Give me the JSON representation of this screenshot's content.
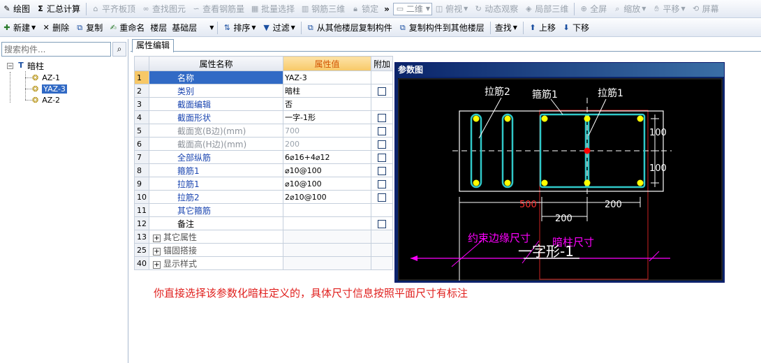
{
  "toolbar1": {
    "items": [
      {
        "label": "绘图",
        "icon": "pencil-icon",
        "disabled": false
      },
      {
        "label": "汇总计算",
        "icon": "sigma-icon",
        "disabled": false
      },
      {
        "label": "平齐板顶",
        "icon": "align-top-icon",
        "disabled": true
      },
      {
        "label": "查找图元",
        "icon": "binoculars-icon",
        "disabled": true
      },
      {
        "label": "查看钢筋量",
        "icon": "glasses-icon",
        "disabled": true
      },
      {
        "label": "批量选择",
        "icon": "batch-select-icon",
        "disabled": true
      },
      {
        "label": "钢筋三维",
        "icon": "rebar-3d-icon",
        "disabled": true
      },
      {
        "label": "锁定",
        "icon": "lock-icon",
        "disabled": true
      }
    ],
    "overflow": "»",
    "view_combo": "二维",
    "right_items": [
      {
        "label": "俯视",
        "icon": "top-view-icon"
      },
      {
        "label": "动态观察",
        "icon": "orbit-icon"
      },
      {
        "label": "局部三维",
        "icon": "local-3d-icon"
      },
      {
        "label": "全屏",
        "icon": "fullscreen-icon"
      },
      {
        "label": "缩放",
        "icon": "zoom-icon"
      },
      {
        "label": "平移",
        "icon": "pan-icon"
      },
      {
        "label": "屏幕",
        "icon": "screen-icon"
      }
    ]
  },
  "toolbar2": {
    "new": "新建",
    "delete": "删除",
    "copy": "复制",
    "rename": "重命名",
    "floor_label": "楼层",
    "floor_value": "基础层",
    "sort": "排序",
    "filter": "过滤",
    "copy_from": "从其他楼层复制构件",
    "copy_to": "复制构件到其他楼层",
    "find": "查找",
    "move_up": "上移",
    "move_down": "下移"
  },
  "search": {
    "placeholder": "搜索构件..."
  },
  "tree": {
    "root": "暗柱",
    "items": [
      "AZ-1",
      "YAZ-3",
      "AZ-2"
    ]
  },
  "tab": {
    "label": "属性编辑"
  },
  "grid": {
    "headers": {
      "name": "属性名称",
      "value": "属性值",
      "extra": "附加"
    },
    "rows": [
      {
        "n": "1",
        "name": "名称",
        "value": "YAZ-3",
        "cb": false
      },
      {
        "n": "2",
        "name": "类别",
        "value": "暗柱",
        "cb": true
      },
      {
        "n": "3",
        "name": "截面编辑",
        "value": "否",
        "cb": false
      },
      {
        "n": "4",
        "name": "截面形状",
        "value": "一字-1形",
        "cb": true
      },
      {
        "n": "5",
        "name": "截面宽(B边)(mm)",
        "value": "700",
        "cb": true
      },
      {
        "n": "6",
        "name": "截面高(H边)(mm)",
        "value": "200",
        "cb": true
      },
      {
        "n": "7",
        "name": "全部纵筋",
        "value": "6⌀16+4⌀12",
        "cb": true
      },
      {
        "n": "8",
        "name": "箍筋1",
        "value": "⌀10@100",
        "cb": true
      },
      {
        "n": "9",
        "name": "拉筋1",
        "value": "⌀10@100",
        "cb": true
      },
      {
        "n": "10",
        "name": "拉筋2",
        "value": "2⌀10@100",
        "cb": true
      },
      {
        "n": "11",
        "name": "其它箍筋",
        "value": "",
        "cb": false
      },
      {
        "n": "12",
        "name": "备注",
        "value": "",
        "cb": true
      },
      {
        "n": "13",
        "name": "其它属性",
        "value": "",
        "cb": false
      },
      {
        "n": "25",
        "name": "锚固搭接",
        "value": "",
        "cb": false
      },
      {
        "n": "40",
        "name": "显示样式",
        "value": "",
        "cb": false
      }
    ]
  },
  "param": {
    "title": "参数图",
    "labels": {
      "tie2": "拉筋2",
      "stirrup1": "箍筋1",
      "tie1": "拉筋1",
      "dim_100_top": "100",
      "dim_100_bottom": "100",
      "dim_500": "500",
      "dim_200_a": "200",
      "dim_200_b": "200",
      "edge": "约束边缘尺寸",
      "hidden": "暗柱尺寸",
      "shape": "一字形-1"
    },
    "colors": {
      "rebar": "#30c8c8",
      "bar": "#ffff00",
      "center": "#ff0000",
      "dim": "#ff00ff",
      "outline": "#ffffff",
      "frame": "#cc2222"
    }
  },
  "note": "你直接选择该参数化暗柱定义的，具体尺寸信息按照平面尺寸有标注"
}
